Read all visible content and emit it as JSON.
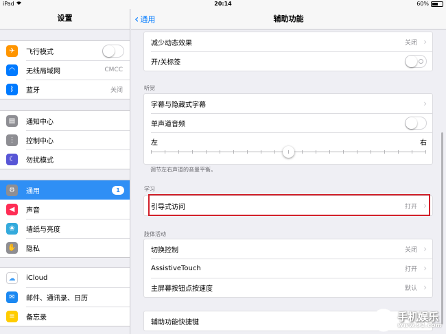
{
  "status_bar": {
    "device": "iPad",
    "time": "20:14",
    "battery": "60%",
    "battery_level": 0.6
  },
  "sidebar": {
    "title": "设置",
    "groups": [
      {
        "items": [
          {
            "label": "飞行模式",
            "icon": "airplane-icon",
            "color": "#ff9500",
            "control": "toggle"
          },
          {
            "label": "无线局域网",
            "icon": "wifi-icon",
            "color": "#007aff",
            "value": "CMCC"
          },
          {
            "label": "蓝牙",
            "icon": "bluetooth-icon",
            "color": "#007aff",
            "value": "关闭"
          }
        ]
      },
      {
        "items": [
          {
            "label": "通知中心",
            "icon": "notification-center-icon",
            "color": "#8e8e93"
          },
          {
            "label": "控制中心",
            "icon": "control-center-icon",
            "color": "#8e8e93"
          },
          {
            "label": "勿扰模式",
            "icon": "moon-icon",
            "color": "#5856d6"
          }
        ]
      },
      {
        "items": [
          {
            "label": "通用",
            "icon": "gear-icon",
            "color": "#8e8e93",
            "badge": "1",
            "selected": true
          },
          {
            "label": "声音",
            "icon": "speaker-icon",
            "color": "#ff2d55"
          },
          {
            "label": "墙纸与亮度",
            "icon": "flower-icon",
            "color": "#34aadc"
          },
          {
            "label": "隐私",
            "icon": "hand-icon",
            "color": "#8e8e93"
          }
        ]
      },
      {
        "items": [
          {
            "label": "iCloud",
            "icon": "cloud-icon",
            "color": "#ffffff"
          },
          {
            "label": "邮件、通讯录、日历",
            "icon": "mail-icon",
            "color": "#1b88f2"
          },
          {
            "label": "备忘录",
            "icon": "notes-icon",
            "color": "#ffcc00"
          }
        ]
      }
    ]
  },
  "nav": {
    "back_label": "通用",
    "title": "辅助功能"
  },
  "main": {
    "group1": [
      {
        "label": "减少动态效果",
        "value": "关闭",
        "chevron": true
      },
      {
        "label": "开/关标签",
        "toggle": true
      }
    ],
    "hearing": {
      "label": "听觉",
      "rows": [
        {
          "label": "字幕与隐藏式字幕",
          "chevron": true
        },
        {
          "label": "单声道音频",
          "toggle": true
        }
      ],
      "balance": {
        "left": "左",
        "right": "右",
        "value": 0.5
      },
      "footnote": "调节左右声道的音量平衡。"
    },
    "learning": {
      "label": "学习",
      "rows": [
        {
          "label": "引导式访问",
          "value": "打开",
          "chevron": true
        }
      ]
    },
    "physical": {
      "label": "肢体活动",
      "rows": [
        {
          "label": "切换控制",
          "value": "关闭",
          "chevron": true
        },
        {
          "label": "AssistiveTouch",
          "value": "打开",
          "chevron": true
        },
        {
          "label": "主屏幕按钮点按速度",
          "value": "默认",
          "chevron": true
        }
      ]
    },
    "shortcut": {
      "label": "辅助功能快捷键"
    }
  },
  "highlight_color": "#d2202a",
  "watermark": {
    "text": "手机娱乐",
    "url": "www.91.com"
  }
}
